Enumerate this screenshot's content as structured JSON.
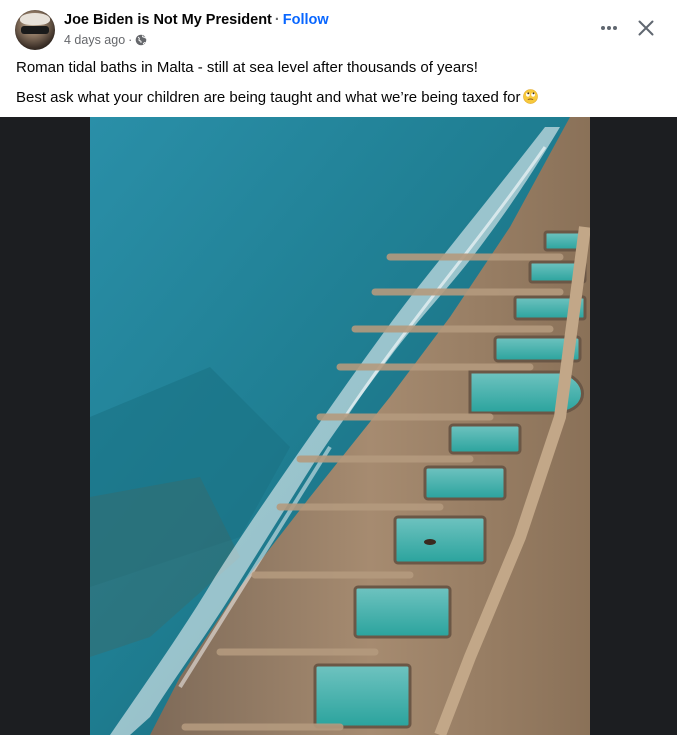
{
  "post": {
    "author": "Joe Biden is Not My President",
    "separator": "·",
    "follow_label": "Follow",
    "timestamp": "4 days ago",
    "meta_separator": "·",
    "audience_icon": "globe-icon",
    "line1": "Roman tidal baths in Malta - still at sea level after thousands of years!",
    "line2": "Best ask what your children are being taught and what we’re being taxed for",
    "line2_emoji": "face-with-rolling-eyes-emoji"
  },
  "actions": {
    "more_icon": "more-options-icon",
    "close_icon": "close-icon"
  },
  "colors": {
    "follow_link": "#0866ff",
    "secondary_text": "#65676b",
    "media_background": "#1c1e21"
  }
}
